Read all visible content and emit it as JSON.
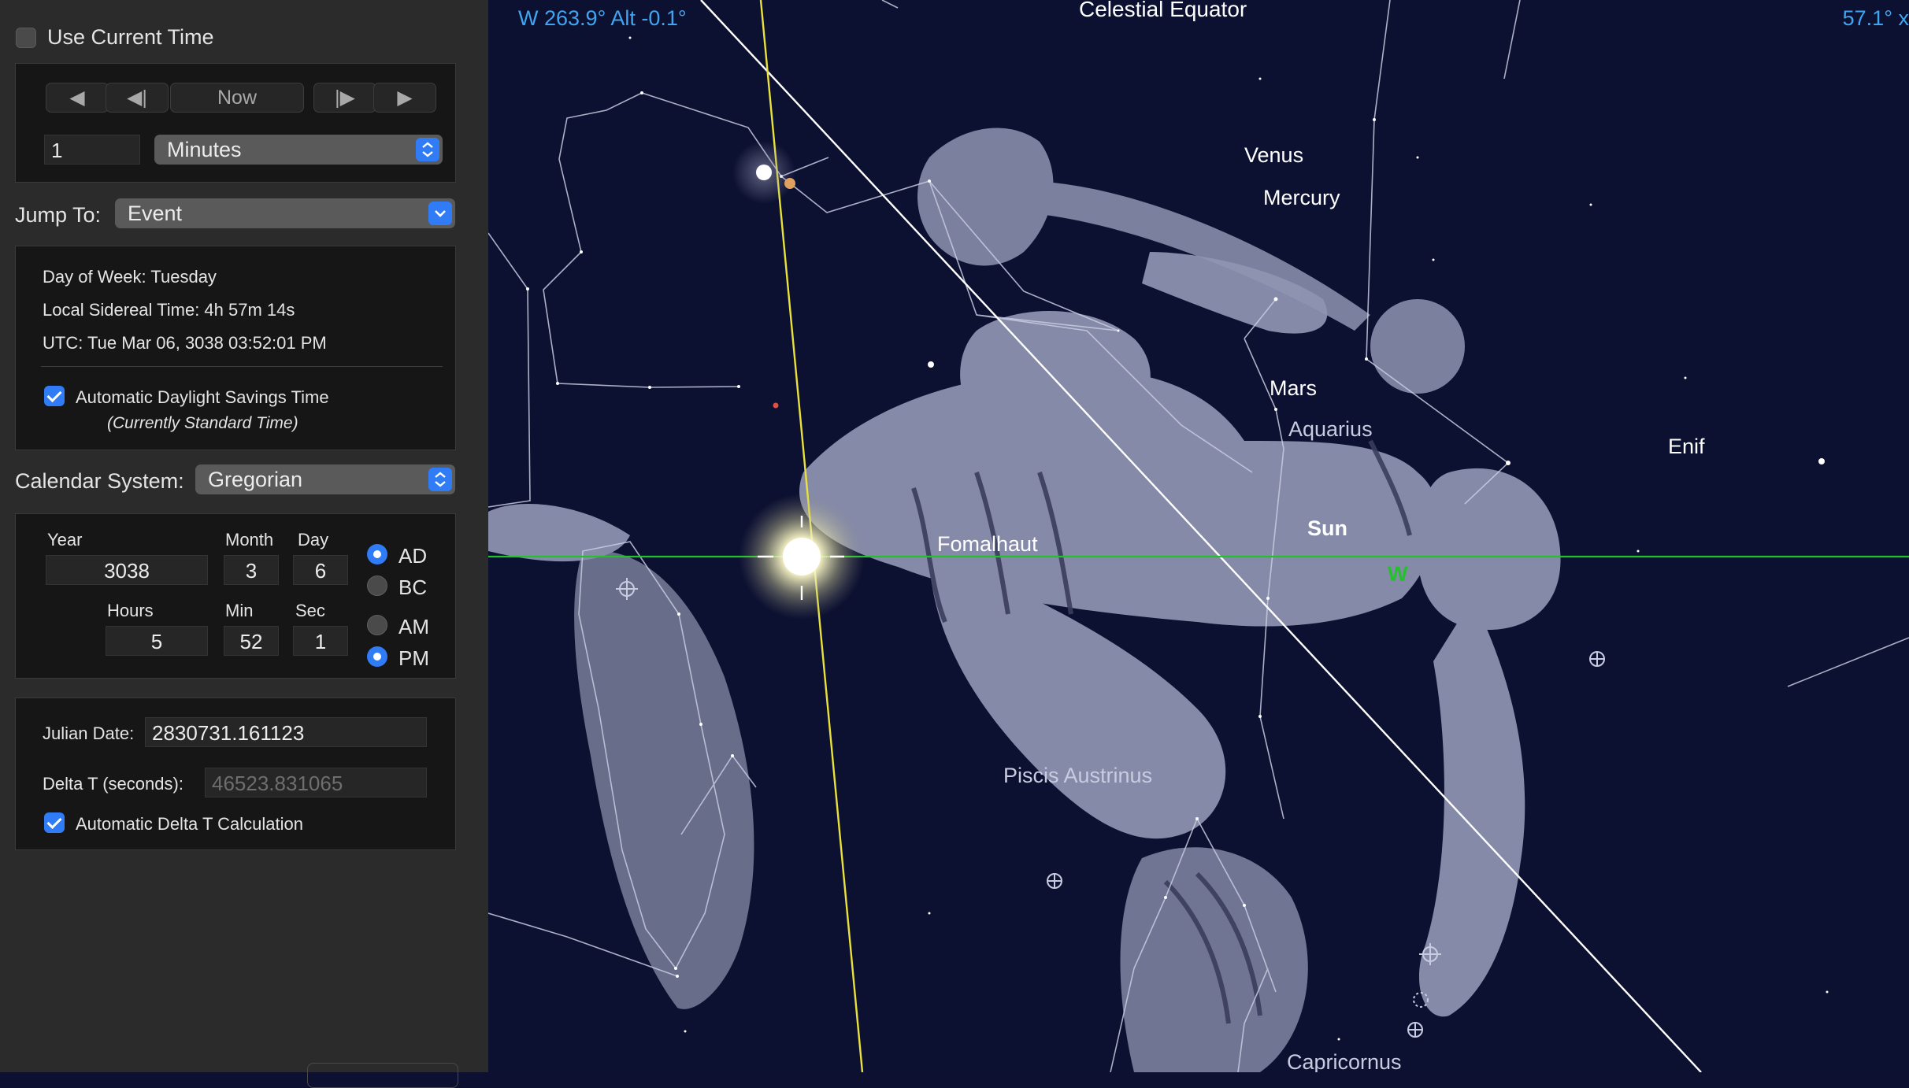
{
  "panel": {
    "use_current_time": "Use Current Time",
    "step": {
      "now_label": "Now",
      "amount_value": "1",
      "unit_value": "Minutes"
    },
    "jump_to": {
      "label": "Jump To:",
      "value": "Event"
    },
    "info": {
      "day_of_week": "Day of Week:  Tuesday",
      "sidereal": "Local Sidereal Time:  4h 57m 14s",
      "utc": "UTC:  Tue Mar 06, 3038  03:52:01 PM",
      "auto_dst_label": "Automatic Daylight Savings Time",
      "dst_note": "(Currently Standard Time)"
    },
    "calendar": {
      "label": "Calendar System:",
      "value": "Gregorian"
    },
    "datetime": {
      "year_label": "Year",
      "year": "3038",
      "month_label": "Month",
      "month": "3",
      "day_label": "Day",
      "day": "6",
      "hours_label": "Hours",
      "hours": "5",
      "min_label": "Min",
      "min": "52",
      "sec_label": "Sec",
      "sec": "1",
      "ad": "AD",
      "bc": "BC",
      "am": "AM",
      "pm": "PM"
    },
    "julian": {
      "label": "Julian Date:",
      "value": "2830731.161123",
      "delta_label": "Delta T (seconds):",
      "delta_value": "46523.831065",
      "auto_delta_label": "Automatic Delta T Calculation"
    }
  },
  "sky": {
    "az_alt": "W 263.9° Alt -0.1°",
    "fov": "57.1° x",
    "labels": {
      "celestial_equator": "Celestial Equator",
      "venus": "Venus",
      "mercury": "Mercury",
      "mars": "Mars",
      "aquarius": "Aquarius",
      "sun": "Sun",
      "fomalhaut": "Fomalhaut",
      "west": "W",
      "enif": "Enif",
      "piscis_austrinus": "Piscis Austrinus",
      "capricornus": "Capricornus"
    },
    "colors": {
      "readout": "#3fa5f0",
      "horizon": "#22c22a",
      "ecliptic": "#e8e23a",
      "equator": "#ffffff"
    }
  }
}
